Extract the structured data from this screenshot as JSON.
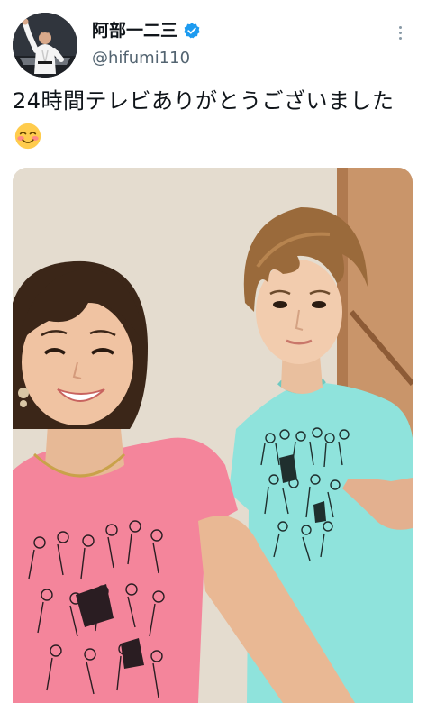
{
  "tweet": {
    "display_name": "阿部一二三",
    "handle": "@hifumi110",
    "text": "24時間テレビありがとうございました",
    "text_emoji": "smiling-face-with-blush-emoji"
  },
  "icons": {
    "verified": "verified-badge-icon",
    "more": "more-options-icon"
  },
  "colors": {
    "accent": "#1d9bf0",
    "secondary_text": "#536471",
    "pink_shirt": "#f4859b",
    "mint_shirt": "#8fe3dc"
  }
}
